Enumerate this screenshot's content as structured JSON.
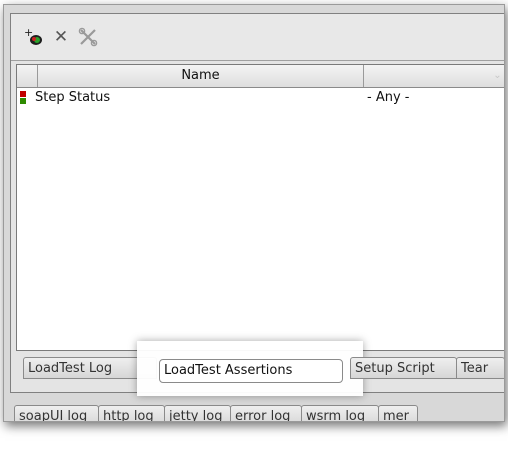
{
  "toolbar": {
    "add_icon": "add-assertion-icon",
    "delete_icon": "delete-icon",
    "configure_icon": "configure-tools-icon"
  },
  "table": {
    "columns": [
      "Name",
      ""
    ],
    "rows": [
      {
        "icon": "status-indicator-icon",
        "name": "Step Status",
        "value": "- Any -"
      }
    ]
  },
  "inner_tabs": [
    "LoadTest Log",
    "LoadTest Assertions",
    "Setup Script",
    "Tear"
  ],
  "selected_inner_tab": "LoadTest Assertions",
  "log_tabs": [
    "soapUI log",
    "http log",
    "jetty log",
    "error log",
    "wsrm log",
    "mer"
  ],
  "colors": {
    "indicator_red": "#c00000",
    "indicator_green": "#2e8b00"
  }
}
